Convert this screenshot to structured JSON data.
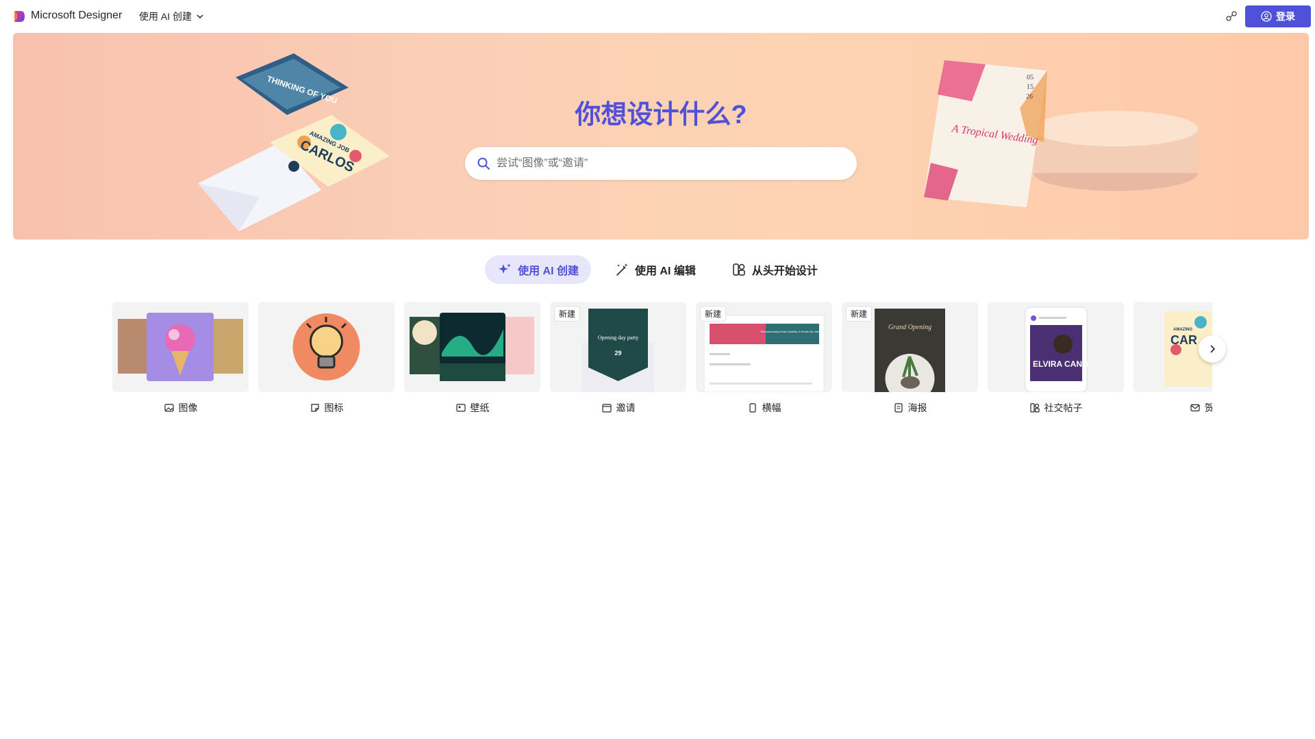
{
  "header": {
    "brand": "Microsoft Designer",
    "mode_menu_label": "使用 AI 创建",
    "login_label": "登录",
    "accent_color": "#4f52d9"
  },
  "hero": {
    "title": "你想设计什么?",
    "search_placeholder": "尝试“图像”或“邀请”",
    "decor_left": {
      "card_top_text": "THINKING OF YOU",
      "card_mid_text": "AMAZING JOB",
      "card_name": "CARLOS"
    },
    "decor_right": {
      "invite_title": "A Tropical Wedding",
      "invite_date": [
        "05",
        "15",
        "26"
      ]
    }
  },
  "tabs": [
    {
      "label": "使用 AI 创建",
      "icon": "sparkle-icon",
      "active": true
    },
    {
      "label": "使用 AI 编辑",
      "icon": "magic-wand-icon",
      "active": false
    },
    {
      "label": "从头开始设计",
      "icon": "shapes-icon",
      "active": false
    }
  ],
  "cards": [
    {
      "label": "图像",
      "icon": "image-sparkle-icon",
      "badge": ""
    },
    {
      "label": "图标",
      "icon": "sticker-icon",
      "badge": ""
    },
    {
      "label": "壁纸",
      "icon": "wallpaper-icon",
      "badge": ""
    },
    {
      "label": "邀请",
      "icon": "calendar-icon",
      "badge": "新建",
      "preview": {
        "title": "Opening day party",
        "date": "29"
      }
    },
    {
      "label": "横幅",
      "icon": "banner-icon",
      "badge": "新建",
      "preview": {
        "title": "Reconstructing Urban Mobility: A Small City Initiative"
      }
    },
    {
      "label": "海报",
      "icon": "poster-icon",
      "badge": "新建",
      "preview": {
        "title": "Grand Opening"
      }
    },
    {
      "label": "社交帖子",
      "icon": "social-post-icon",
      "badge": "",
      "preview": {
        "name": "ELVIRA CANO"
      }
    },
    {
      "label": "贺",
      "icon": "mail-icon",
      "badge": "",
      "preview": {
        "text": "AMAZING",
        "name": "CAR"
      }
    }
  ]
}
